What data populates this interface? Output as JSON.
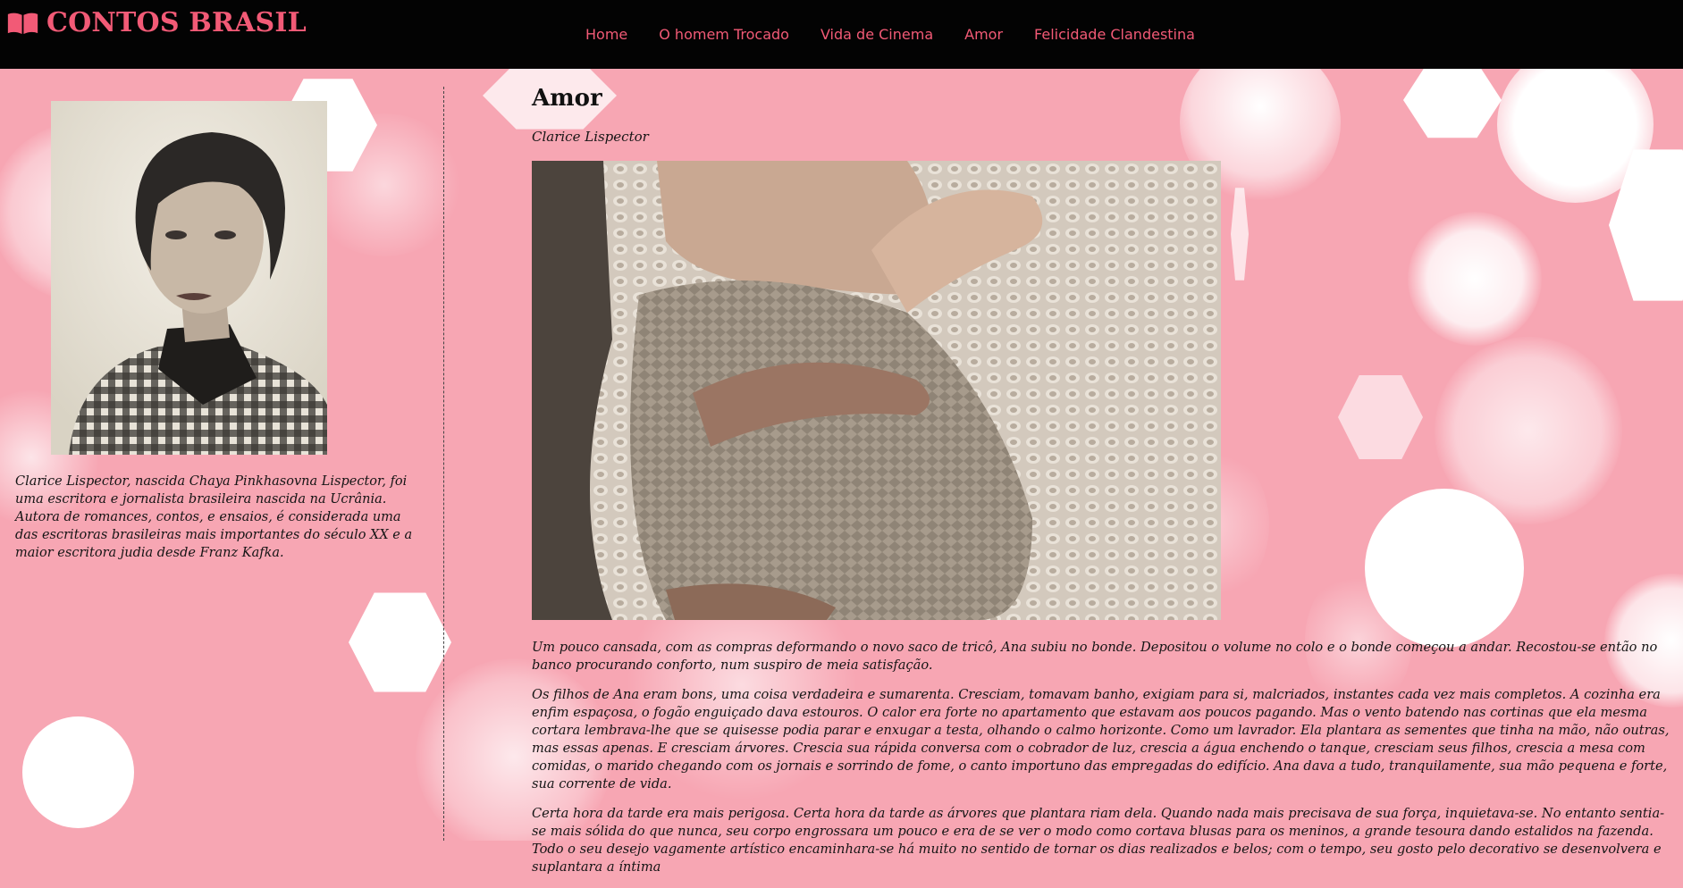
{
  "brand": {
    "title": "CONTOS BRASIL",
    "icon": "book-icon"
  },
  "nav": [
    {
      "label": "Home"
    },
    {
      "label": "O homem Trocado"
    },
    {
      "label": "Vida de Cinema"
    },
    {
      "label": "Amor"
    },
    {
      "label": "Felicidade Clandestina"
    }
  ],
  "sidebar": {
    "portrait": "black-and-white portrait photo of Clarice Lispector",
    "bio": "Clarice Lispector, nascida Chaya Pinkhasovna Lispector, foi uma escritora e jornalista brasileira nascida na Ucrânia. Autora de romances, contos, e ensaios, é considerada uma das escritoras brasileiras mais importantes do século XX e a maior escritora judia desde Franz Kafka."
  },
  "story": {
    "title": "Amor",
    "author": "Clarice Lispector",
    "paragraphs": [
      "Um pouco cansada, com as compras deformando o novo saco de tricô, Ana subiu no bonde. Depositou o volume no colo e o bonde começou a andar. Recostou-se então no banco procurando conforto, num suspiro de meia satisfação.",
      "Os filhos de Ana eram bons, uma coisa verdadeira e sumarenta. Cresciam, tomavam banho, exigiam para si, malcriados, instantes cada vez mais completos. A cozinha era enfim espaçosa, o fogão enguiçado dava estouros. O calor era forte no apartamento que estavam aos poucos pagando. Mas o vento batendo nas cortinas que ela mesma cortara lembrava-lhe que se quisesse podia parar e enxugar a testa, olhando o calmo horizonte. Como um lavrador. Ela plantara as sementes que tinha na mão, não outras, mas essas apenas. E cresciam árvores. Crescia sua rápida conversa com o cobrador de luz, crescia a água enchendo o tanque, cresciam seus filhos, crescia a mesa com comidas, o marido chegando com os jornais e sorrindo de fome, o canto importuno das empregadas do edifício. Ana dava a tudo, tranquilamente, sua mão pequena e forte, sua corrente de vida.",
      "Certa hora da tarde era mais perigosa. Certa hora da tarde as árvores que plantara riam dela. Quando nada mais precisava de sua força, inquietava-se. No entanto sentia-se mais sólida do que nunca, seu corpo engrossara um pouco e era de se ver o modo como cortava blusas para os meninos, a grande tesoura dando estalidos na fazenda. Todo o seu desejo vagamente artístico encaminhara-se há muito no sentido de tornar os dias realizados e belos; com o tempo, seu gosto pelo decorativo se desenvolvera e suplantara a íntima"
    ]
  },
  "colors": {
    "background": "#f7a6b3",
    "header": "#030303",
    "accent": "#f25a76",
    "text": "#151515"
  }
}
